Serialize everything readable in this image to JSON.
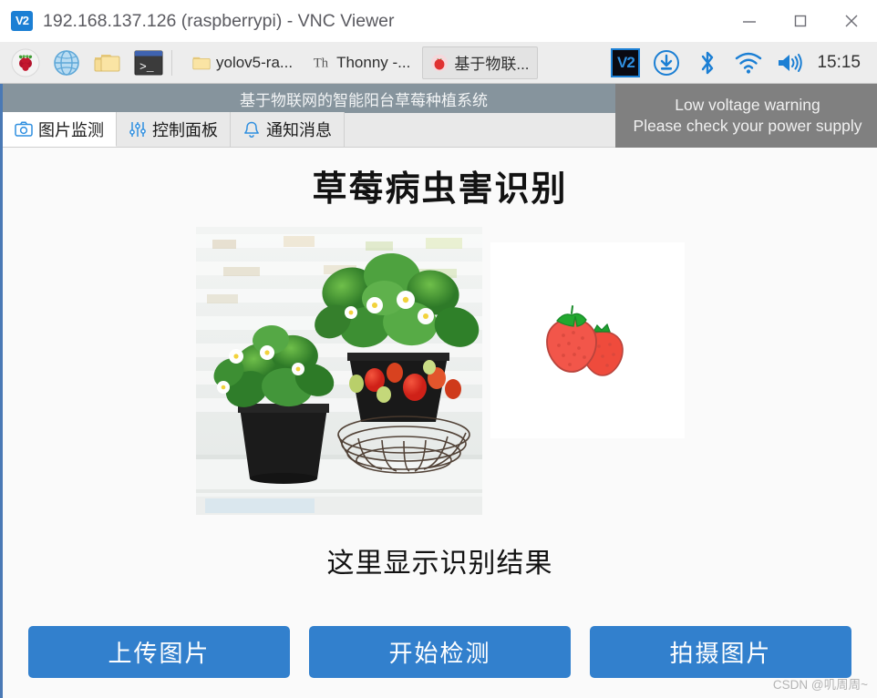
{
  "vnc_window": {
    "logo_text": "V2",
    "logo_icon": "vnc-logo-icon",
    "title": "192.168.137.126 (raspberrypi) - VNC Viewer",
    "controls": {
      "minimize": "minimize-icon",
      "maximize": "maximize-icon",
      "close": "close-icon"
    }
  },
  "taskbar": {
    "launchers": [
      {
        "icon": "raspberry-menu-icon",
        "name": "raspberry-pi-menu"
      },
      {
        "icon": "globe-browser-icon",
        "name": "web-browser"
      },
      {
        "icon": "file-manager-icon",
        "name": "file-manager"
      },
      {
        "icon": "terminal-icon",
        "name": "terminal"
      }
    ],
    "windows": [
      {
        "icon": "folder-icon",
        "label": "yolov5-ra...",
        "active": false
      },
      {
        "icon": "thonny-icon",
        "label": "Thonny  -...",
        "active": false
      },
      {
        "icon": "strawberry-app-icon",
        "label": "基于物联...",
        "active": false
      }
    ],
    "tray": [
      {
        "icon": "vnc-server-icon",
        "label": "V2"
      },
      {
        "icon": "update-download-icon"
      },
      {
        "icon": "bluetooth-icon"
      },
      {
        "icon": "wifi-icon"
      },
      {
        "icon": "volume-icon"
      }
    ],
    "clock": "15:15"
  },
  "app": {
    "title": "基于物联网的智能阳台草莓种植系统",
    "tabs": [
      {
        "label": "图片监测",
        "icon": "camera-icon",
        "active": true
      },
      {
        "label": "控制面板",
        "icon": "sliders-icon",
        "active": false
      },
      {
        "label": "通知消息",
        "icon": "bell-icon",
        "active": false
      }
    ],
    "heading": "草莓病虫害识别",
    "photo": {
      "name": "strawberry-plants-photo",
      "alt": "两盆开花结果的草莓盆栽放在白色木架上"
    },
    "result_image": {
      "name": "strawberry-illustration",
      "alt": "两颗红色草莓卡通图标"
    },
    "result_text": "这里显示识别结果",
    "buttons": [
      {
        "label": "上传图片",
        "name": "upload-image-button"
      },
      {
        "label": "开始检测",
        "name": "start-detection-button"
      },
      {
        "label": "拍摄图片",
        "name": "capture-image-button"
      }
    ]
  },
  "notification": {
    "line1": "Low voltage warning",
    "line2": "Please check your power supply"
  },
  "watermark": "CSDN @叽周周~",
  "colors": {
    "button_blue": "#3280cd",
    "app_titlebar_gray": "#86949d",
    "notification_gray": "#808080",
    "taskbar_gray": "#ededed",
    "accent_border_blue": "#4a79b5"
  }
}
